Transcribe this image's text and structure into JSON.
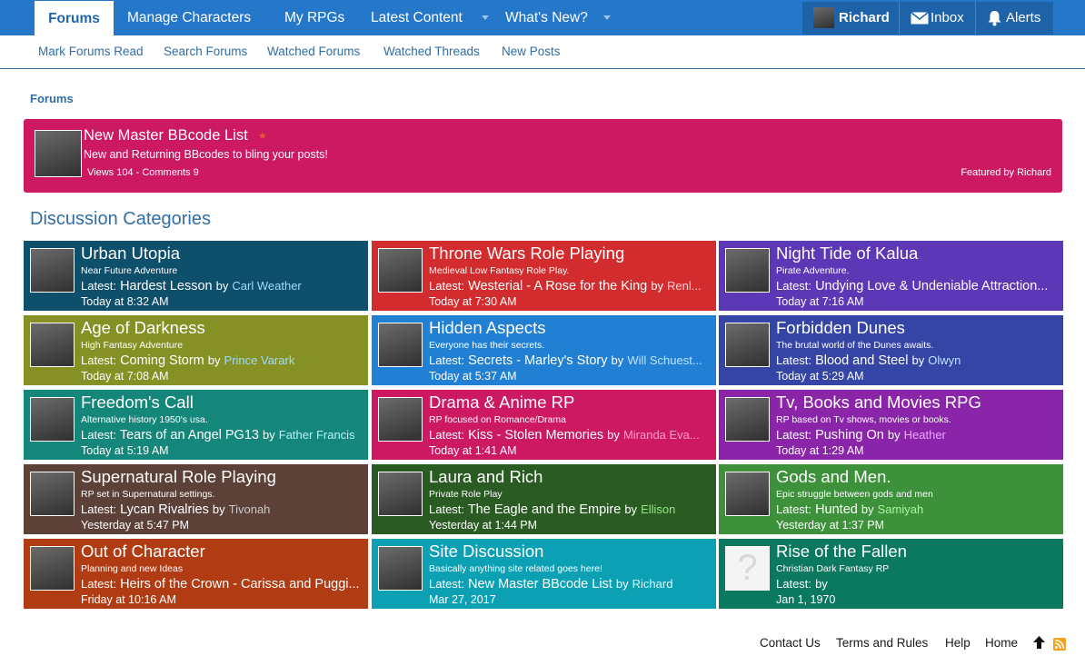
{
  "nav": {
    "tabs": [
      {
        "label": "Forums"
      },
      {
        "label": "Manage Characters"
      },
      {
        "label": "My RPGs"
      },
      {
        "label": "Latest Content"
      },
      {
        "label": "What's New?"
      }
    ],
    "user": "Richard",
    "inbox": "Inbox",
    "alerts": "Alerts"
  },
  "subnav": [
    "Mark Forums Read",
    "Search Forums",
    "Watched Forums",
    "Watched Threads",
    "New Posts"
  ],
  "breadcrumb": "Forums",
  "featured": {
    "title": "New Master BBcode List",
    "desc": "New and Returning BBcodes to bling your posts!",
    "stats": "Views 104 - Comments 9",
    "by": "Featured by Richard",
    "color": "#cd1862"
  },
  "section_title": "Discussion Categories",
  "categories": [
    {
      "name": "Urban Utopia",
      "desc": "Near Future Adventure",
      "latest_label": "Latest:",
      "thread": "Hardest Lesson",
      "by": "by",
      "user": "Carl Weather",
      "when": "Today at 8:32 AM",
      "color": "#0e4f6b",
      "user_color": "#9fdcff"
    },
    {
      "name": "Throne Wars Role Playing",
      "desc": "Medieval Low Fantasy Role Play.",
      "latest_label": "Latest:",
      "thread": "Westerial - A Rose for the King",
      "by": "by",
      "user": "Renl...",
      "when": "Today at 7:30 AM",
      "color": "#d32c2e",
      "user_color": "#f0d0d0"
    },
    {
      "name": "Night Tide of Kalua",
      "desc": "Pirate Adventure.",
      "latest_label": "Latest:",
      "thread": "Undying Love & Undeniable Attraction...",
      "by": "",
      "user": "",
      "when": "Today at 7:16 AM",
      "color": "#5c37b6",
      "user_color": "#ffffff"
    },
    {
      "name": "Age of Darkness",
      "desc": "High Fantasy Adventure",
      "latest_label": "Latest:",
      "thread": "Coming Storm",
      "by": "by",
      "user": "Prince Varark",
      "when": "Today at 7:08 AM",
      "color": "#859124",
      "user_color": "#9fdcff"
    },
    {
      "name": "Hidden Aspects",
      "desc": "Everyone has their secrets.",
      "latest_label": "Latest:",
      "thread": "Secrets - Marley's Story",
      "by": "by",
      "user": "Will Schuest...",
      "when": "Today at 5:37 AM",
      "color": "#2180d4",
      "user_color": "#bfe3ff"
    },
    {
      "name": "Forbidden Dunes",
      "desc": "The brutal world of the Dunes awaits.",
      "latest_label": "Latest:",
      "thread": "Blood and Steel",
      "by": "by",
      "user": "Olwyn",
      "when": "Today at 5:29 AM",
      "color": "#3545a6",
      "user_color": "#bfe3ff"
    },
    {
      "name": "Freedom's Call",
      "desc": "Alternative history 1950's usa.",
      "latest_label": "Latest:",
      "thread": "Tears of an Angel PG13",
      "by": "by",
      "user": "Father Francis",
      "when": "Today at 5:19 AM",
      "color": "#14877a",
      "user_color": "#b8f0ff"
    },
    {
      "name": "Drama & Anime RP",
      "desc": "RP focused on Romance/Drama",
      "latest_label": "Latest:",
      "thread": "Kiss - Stolen Memories",
      "by": "by",
      "user": "Miranda Eva...",
      "when": "Today at 1:41 AM",
      "color": "#cd1862",
      "user_color": "#ff9ccf"
    },
    {
      "name": "Tv, Books and Movies RPG",
      "desc": "RP based on Tv shows, movies or books.",
      "latest_label": "Latest:",
      "thread": "Pushing On",
      "by": "by",
      "user": "Heather",
      "when": "Today at 1:29 AM",
      "color": "#8a25aa",
      "user_color": "#f3a5ff"
    },
    {
      "name": "Supernatural Role Playing",
      "desc": "RP set in Supernatural settings.",
      "latest_label": "Latest:",
      "thread": "Lycan Rivalries",
      "by": "by",
      "user": "Tivonah",
      "when": "Yesterday at 5:47 PM",
      "color": "#5b4138",
      "user_color": "#c8c8c8"
    },
    {
      "name": "Laura and Rich",
      "desc": "Private Role Play",
      "latest_label": "Latest:",
      "thread": "The Eagle and the Empire",
      "by": "by",
      "user": "Ellison",
      "when": "Yesterday at 1:44 PM",
      "color": "#2a5b23",
      "user_color": "#8eea7e"
    },
    {
      "name": "Gods and Men.",
      "desc": "Epic struggle between gods and men",
      "latest_label": "Latest:",
      "thread": "Hunted",
      "by": "by",
      "user": "Samiyah",
      "when": "Yesterday at 1:37 PM",
      "color": "#3c913a",
      "user_color": "#aef5a0"
    },
    {
      "name": "Out of Character",
      "desc": "Planning and new Ideas",
      "latest_label": "Latest:",
      "thread": "Heirs of the Crown - Carissa and Puggi...",
      "by": "",
      "user": "",
      "when": "Friday at 10:16 AM",
      "color": "#b13b13",
      "user_color": "#ffffff"
    },
    {
      "name": "Site Discussion",
      "desc": "Basically anything site related goes here!",
      "latest_label": "Latest:",
      "thread": "New Master BBcode List",
      "by": "by",
      "user": "Richard",
      "when": "Mar 27, 2017",
      "color": "#0ca0b4",
      "user_color": "#d6faff"
    },
    {
      "name": "Rise of the Fallen",
      "desc": "Christian Dark Fantasy RP",
      "latest_label": "Latest:",
      "thread": "",
      "by": "by",
      "user": "",
      "when": "Jan 1, 1970",
      "color": "#0b7960",
      "user_color": "#ffffff"
    }
  ],
  "footer": [
    "Contact Us",
    "Terms and Rules",
    "Help",
    "Home"
  ],
  "icons": {
    "user_avatar": "avatar",
    "inbox": "envelope-icon",
    "alerts": "bell-icon",
    "top": "arrow-up-icon",
    "rss": "rss-icon"
  }
}
